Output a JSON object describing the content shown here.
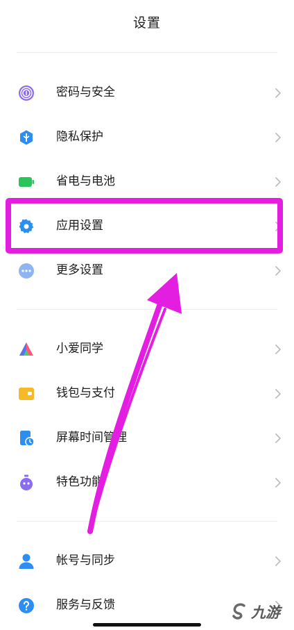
{
  "header": {
    "title": "设置"
  },
  "groups": [
    {
      "items": [
        {
          "label": "密码与安全",
          "icon": "fingerprint-icon"
        },
        {
          "label": "隐私保护",
          "icon": "privacy-shield-icon"
        },
        {
          "label": "省电与电池",
          "icon": "battery-icon"
        },
        {
          "label": "应用设置",
          "icon": "gear-icon"
        },
        {
          "label": "更多设置",
          "icon": "more-dots-icon"
        }
      ]
    },
    {
      "items": [
        {
          "label": "小爱同学",
          "icon": "xiaoai-icon"
        },
        {
          "label": "钱包与支付",
          "icon": "wallet-icon"
        },
        {
          "label": "屏幕时间管理",
          "icon": "screen-time-icon"
        },
        {
          "label": "特色功能",
          "icon": "feature-icon"
        }
      ]
    },
    {
      "items": [
        {
          "label": "帐号与同步",
          "icon": "account-icon"
        },
        {
          "label": "服务与反馈",
          "icon": "help-icon"
        }
      ]
    }
  ],
  "watermark": {
    "text": "九游"
  },
  "colors": {
    "annotation": "#e31ee0",
    "blue": "#2d8ef0",
    "green": "#29c45a",
    "yellow": "#f6b928",
    "purple": "#8a6cf0"
  }
}
